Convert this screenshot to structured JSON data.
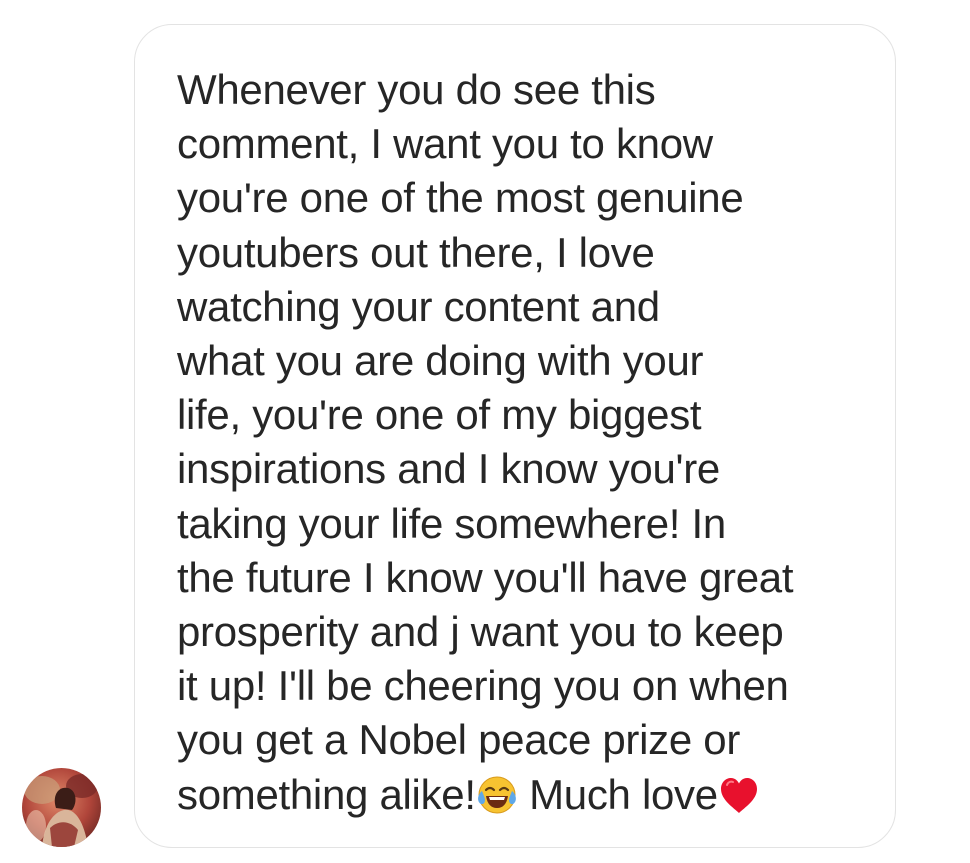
{
  "message": {
    "lines": [
      "Whenever you do see this",
      "comment, I want you to know",
      "you're one of the most genuine",
      "youtubers out there, I love",
      "watching your content and",
      "what you are doing with your",
      "life, you're one of my biggest",
      "inspirations and I know you're",
      "taking your life somewhere! In",
      "the future I know you'll have great",
      "prosperity and j want you to keep",
      "it up! I'll be cheering you on when",
      "you get a Nobel peace prize or"
    ],
    "last_line_start": "something alike!",
    "last_line_middle": " Much love",
    "emojis": [
      "face-with-tears-of-joy-icon",
      "red-heart-icon"
    ]
  },
  "colors": {
    "text": "#262626",
    "bubble_border": "#e3e3e3",
    "heart": "#e8112d",
    "emoji_face": "#f7c331"
  }
}
